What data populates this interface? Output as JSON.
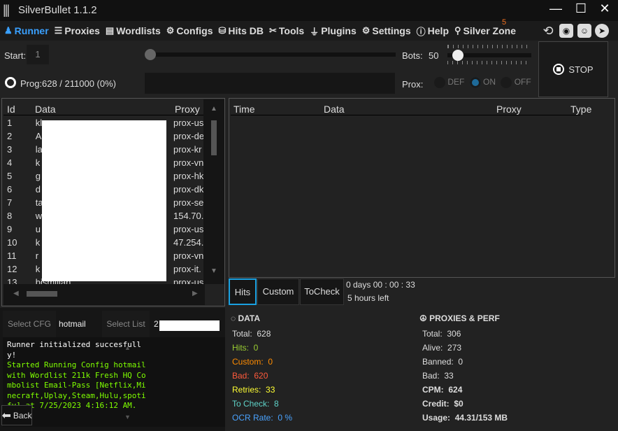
{
  "window": {
    "title": "SilverBullet 1.1.2"
  },
  "nav": [
    {
      "label": "Runner",
      "icon": "runner-icon"
    },
    {
      "label": "Proxies",
      "icon": "server-icon"
    },
    {
      "label": "Wordlists",
      "icon": "document-icon"
    },
    {
      "label": "Configs",
      "icon": "gear-icon"
    },
    {
      "label": "Hits DB",
      "icon": "database-icon"
    },
    {
      "label": "Tools",
      "icon": "tools-icon"
    },
    {
      "label": "Plugins",
      "icon": "plug-icon"
    },
    {
      "label": "Settings",
      "icon": "settings-icon"
    },
    {
      "label": "Help",
      "icon": "help-icon"
    },
    {
      "label": "Silver Zone",
      "icon": "location-icon"
    }
  ],
  "silver_zone_badge": "5",
  "controls": {
    "start_label": "Start:",
    "start_value": "1",
    "bots_label": "Bots:",
    "bots_value": "50",
    "prog_label": "Prog:",
    "prog_value": "628 / 211000 (0%)",
    "prox_label": "Prox:",
    "prox_options": [
      "DEF",
      "ON",
      "OFF"
    ],
    "prox_selected": "ON",
    "stop_label": "STOP"
  },
  "data_table": {
    "columns": [
      "Id",
      "Data",
      "Proxy"
    ],
    "rows": [
      [
        "1",
        "kl",
        "prox-us"
      ],
      [
        "2",
        "A",
        "prox-de"
      ],
      [
        "3",
        "la",
        "prox-kr"
      ],
      [
        "4",
        "k",
        "prox-vn"
      ],
      [
        "5",
        "g",
        "prox-hk"
      ],
      [
        "6",
        "d",
        "prox-dk"
      ],
      [
        "7",
        "ta",
        "prox-se"
      ],
      [
        "8",
        "w",
        "154.70."
      ],
      [
        "9",
        "u",
        "prox-us"
      ],
      [
        "10",
        "k",
        "47.254."
      ],
      [
        "11",
        "r",
        "prox-vn"
      ],
      [
        "12",
        "k",
        "prox-it."
      ],
      [
        "13",
        "bismillah",
        "prox-us"
      ]
    ]
  },
  "hits_table": {
    "columns": [
      "Time",
      "Data",
      "Proxy",
      "Type"
    ]
  },
  "tabs": [
    "Hits",
    "Custom",
    "ToCheck"
  ],
  "active_tab": "Hits",
  "timer": {
    "elapsed": "0  days  00 : 00 : 33",
    "remaining": "5 hours left"
  },
  "selectors": {
    "cfg_button": "Select CFG",
    "cfg_value": "hotmail",
    "list_button": "Select List",
    "list_value": "2"
  },
  "log": [
    {
      "text": "Runner initialized succesfully!",
      "color": "#ffffff"
    },
    {
      "text": "Started Running Config hotmail with Wordlist 211k Fresh HQ Combolist Email-Pass [Netflix,Minecraft,Uplay,Steam,Hulu,spotify] at 7/25/2023 4:16:12 AM.",
      "color": "#7fff00"
    }
  ],
  "back_label": "Back",
  "data_stats": {
    "title": "DATA",
    "items": [
      {
        "label": "Total:",
        "value": "628",
        "color": "#dddddd"
      },
      {
        "label": "Hits:",
        "value": "0",
        "color": "#9acd32"
      },
      {
        "label": "Custom:",
        "value": "0",
        "color": "#ff8c00"
      },
      {
        "label": "Bad:",
        "value": "620",
        "color": "#ff5a3c"
      },
      {
        "label": "Retries:",
        "value": "33",
        "color": "#ffff33"
      },
      {
        "label": "To Check:",
        "value": "8",
        "color": "#5fd3c8"
      },
      {
        "label": "OCR Rate:",
        "value": "0 %",
        "color": "#4aa3ff"
      }
    ]
  },
  "perf_stats": {
    "title": "PROXIES & PERF",
    "items": [
      {
        "label": "Total:",
        "value": "306",
        "bold": false
      },
      {
        "label": "Alive:",
        "value": "273",
        "bold": false
      },
      {
        "label": "Banned:",
        "value": "0",
        "bold": false
      },
      {
        "label": "Bad:",
        "value": "33",
        "bold": false
      },
      {
        "label": "CPM:",
        "value": "624",
        "bold": true
      },
      {
        "label": "Credit:",
        "value": "$0",
        "bold": true
      },
      {
        "label": "Usage:",
        "value": "44.31/153 MB",
        "bold": true
      }
    ]
  },
  "colors": {
    "accent": "#3aa0ff",
    "badge": "#f07020"
  }
}
